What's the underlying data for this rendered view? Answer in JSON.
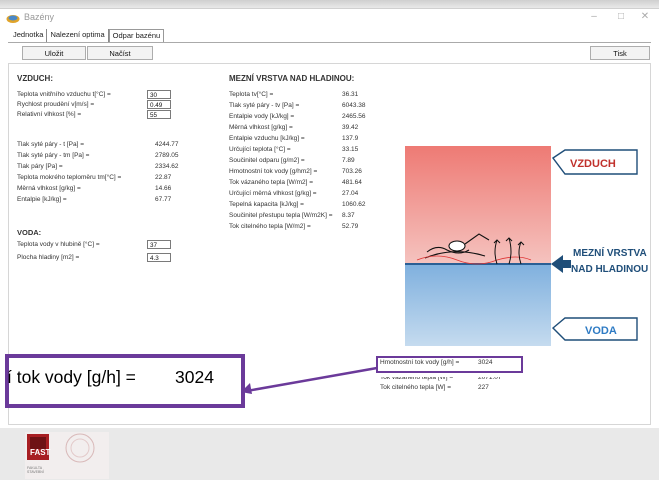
{
  "window": {
    "title": "Bazény",
    "min_icon": "minimize-icon",
    "max_icon": "maximize-icon",
    "close_icon": "close-icon",
    "close_glyph": "✕"
  },
  "tabs": [
    {
      "label": "Jednotka"
    },
    {
      "label": "Nalezení optima"
    },
    {
      "label": "Odpar bazénu"
    }
  ],
  "toolbar": {
    "save_label": "Uložit",
    "load_label": "Načíst",
    "print_label": "Tisk"
  },
  "air": {
    "heading": "VZDUCH:",
    "inputs": [
      {
        "label": "Teplota vnitřního vzduchu t[°C] =",
        "value": "30"
      },
      {
        "label": "Rychlost proudění v[m/s] =",
        "value": "0.49"
      },
      {
        "label": "Relativní vlhkost [%] =",
        "value": "55"
      }
    ],
    "outputs": [
      {
        "label": "Tlak syté páry - t [Pa] =",
        "value": "4244.77"
      },
      {
        "label": "Tlak syté páry - tm [Pa] =",
        "value": "2789.05"
      },
      {
        "label": "Tlak páry [Pa] =",
        "value": "2334.62"
      },
      {
        "label": "Teplota mokrého teploměru tm[°C] =",
        "value": "22.87"
      },
      {
        "label": "Měrná vlhkost [g/kg] =",
        "value": "14.66"
      },
      {
        "label": "Entalpie [kJ/kg] =",
        "value": "67.77"
      }
    ]
  },
  "water": {
    "heading": "VODA:",
    "inputs": [
      {
        "label": "Teplota vody v hlubině [°C] =",
        "value": "37"
      },
      {
        "label": "Plocha hladiny [m2] =",
        "value": "4.3"
      }
    ]
  },
  "boundary": {
    "heading": "MEZNÍ VRSTVA NAD HLADINOU:",
    "rows": [
      {
        "label": "Teplota tv[°C] =",
        "value": "36.31"
      },
      {
        "label": "Tlak syté páry - tv [Pa] =",
        "value": "6043.38"
      },
      {
        "label": "Entalpie vody [kJ/kg] =",
        "value": "2465.56"
      },
      {
        "label": "Měrná vlhkost [g/kg] =",
        "value": "39.42"
      },
      {
        "label": "Entalpie vzduchu [kJ/kg] =",
        "value": "137.9"
      },
      {
        "label": "Určující teplota [°C] =",
        "value": "33.15"
      },
      {
        "label": "Součinitel odparu [g/m2] =",
        "value": "7.89"
      },
      {
        "label": "Hmotnostní tok vody [g/hm2] =",
        "value": "703.26"
      },
      {
        "label": "Tok vázaného tepla [W/m2] =",
        "value": "481.64"
      },
      {
        "label": "Určující měrná vlhkost [g/kg] =",
        "value": "27.04"
      },
      {
        "label": "Tepelná kapacita [kJ/kg] =",
        "value": "1060.62"
      },
      {
        "label": "Součinitel přestupu tepla [W/m2K] =",
        "value": "8.37"
      },
      {
        "label": "Tok citelného tepla [W/m2] =",
        "value": "52.79"
      }
    ]
  },
  "illustration": {
    "air_label": "VZDUCH",
    "layer_label_1": "MEZNÍ VRSTVA",
    "layer_label_2": "NAD HLADINOU",
    "water_label": "VODA",
    "air_color": "#f08a84",
    "water_color": "#9cc1e4",
    "arrow_color": "#1f4e79"
  },
  "results": [
    {
      "label": "Hmotnostní tok vody [g/h] =",
      "value": "3024"
    },
    {
      "label": "Tok vázaného tepla [W] =",
      "value": "2071.07"
    },
    {
      "label": "Tok citelného tepla [W] =",
      "value": "227"
    }
  ],
  "callout": {
    "text": "í tok vody [g/h] =",
    "value": "3024",
    "color": "#6b3a9a"
  },
  "logo": {
    "name": "FAST",
    "sub1": "FAKULTA",
    "sub2": "STAVEBNÍ"
  }
}
